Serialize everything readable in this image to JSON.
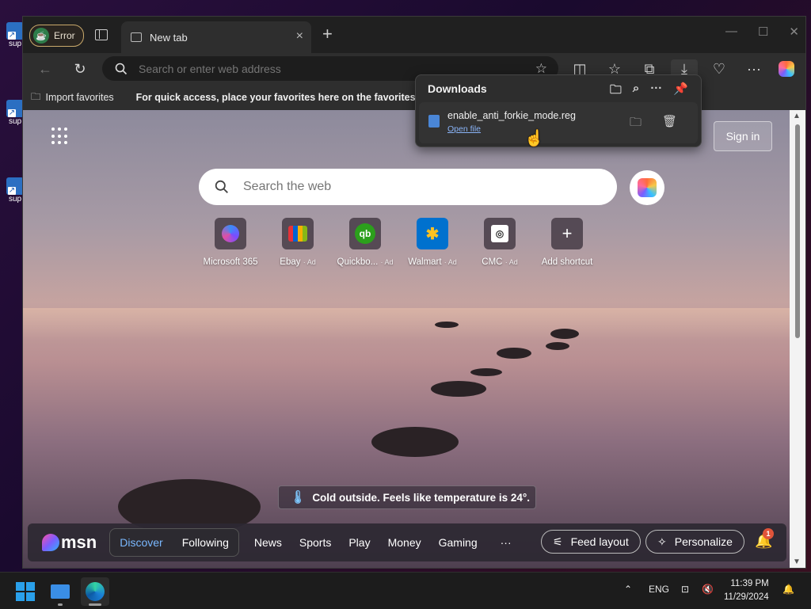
{
  "desktop": {
    "icon_label": "sup"
  },
  "titlebar": {
    "profile_badge": "Error",
    "tab_title": "New tab",
    "close_tab": "×",
    "new_tab": "+",
    "minimize": "—",
    "maximize": "☐",
    "close_window": "✕"
  },
  "toolbar": {
    "address_placeholder": "Search or enter web address"
  },
  "favorites_bar": {
    "import_label": "Import favorites",
    "hint": "For quick access, place your favorites here on the favorites bar."
  },
  "downloads": {
    "title": "Downloads",
    "items": [
      {
        "filename": "enable_anti_forkie_mode.reg",
        "action": "Open file"
      }
    ]
  },
  "newtab": {
    "sign_in": "Sign in",
    "search_placeholder": "Search the web",
    "shortcuts": [
      {
        "label": "Microsoft 365",
        "ad": ""
      },
      {
        "label": "Ebay",
        "ad": "· Ad"
      },
      {
        "label": "Quickbo...",
        "ad": "· Ad"
      },
      {
        "label": "Walmart",
        "ad": "· Ad"
      },
      {
        "label": "CMC",
        "ad": "· Ad"
      },
      {
        "label": "Add shortcut",
        "ad": ""
      }
    ],
    "weather": "Cold outside. Feels like temperature is 24°."
  },
  "msn": {
    "logo": "msn",
    "tabs": [
      "Discover",
      "Following"
    ],
    "nav": [
      "News",
      "Sports",
      "Play",
      "Money",
      "Gaming",
      "···"
    ],
    "feed_layout": "Feed layout",
    "personalize": "Personalize",
    "notification_count": "1"
  },
  "taskbar": {
    "language": "ENG",
    "time": "11:39 PM",
    "date": "11/29/2024"
  },
  "colors": {
    "accent": "#7ab8ff",
    "link": "#8ab4f8",
    "badge": "#e0543a"
  }
}
